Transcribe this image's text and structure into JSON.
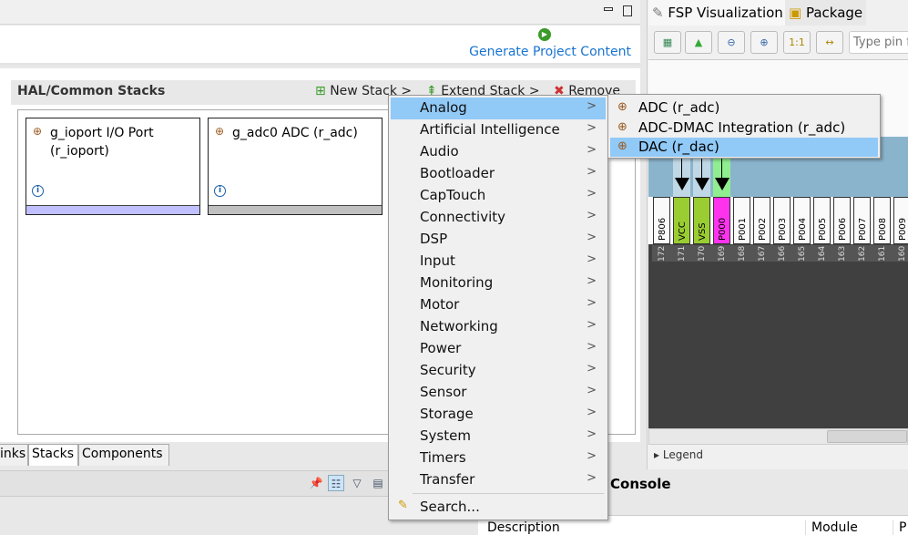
{
  "editor": {
    "generate_label": "Generate Project Content"
  },
  "stacks": {
    "title": "HAL/Common Stacks",
    "new_stack": "New Stack >",
    "extend_stack": "Extend Stack >",
    "remove": "Remove",
    "cards": [
      {
        "label": "g_ioport I/O Port (r_ioport)",
        "bar_color": "#c0c0ff"
      },
      {
        "label": "g_adc0 ADC (r_adc)",
        "bar_color": "#c0c0c0"
      }
    ]
  },
  "bottom_tabs": [
    "inks",
    "Stacks",
    "Components"
  ],
  "console": {
    "title": "Console",
    "columns": [
      "Description",
      "Module",
      "P"
    ]
  },
  "right": {
    "tabs": [
      "FSP Visualization",
      "Package"
    ],
    "search_placeholder": "Type pin f",
    "legend": "Legend",
    "pins": [
      {
        "name": "P806",
        "num": "172"
      },
      {
        "name": "VCC",
        "num": "171",
        "color": "#9acd32"
      },
      {
        "name": "VSS",
        "num": "170",
        "color": "#9acd32"
      },
      {
        "name": "P000",
        "num": "169",
        "color": "#ff33ee"
      },
      {
        "name": "P001",
        "num": "168"
      },
      {
        "name": "P002",
        "num": "167"
      },
      {
        "name": "P003",
        "num": "166"
      },
      {
        "name": "P004",
        "num": "165"
      },
      {
        "name": "P005",
        "num": "164"
      },
      {
        "name": "P006",
        "num": "163"
      },
      {
        "name": "P007",
        "num": "162"
      },
      {
        "name": "P008",
        "num": "161"
      },
      {
        "name": "P009",
        "num": "160"
      }
    ]
  },
  "menu": {
    "items": [
      "Analog",
      "Artificial Intelligence",
      "Audio",
      "Bootloader",
      "CapTouch",
      "Connectivity",
      "DSP",
      "Input",
      "Monitoring",
      "Motor",
      "Networking",
      "Power",
      "Security",
      "Sensor",
      "Storage",
      "System",
      "Timers",
      "Transfer"
    ],
    "search": "Search...",
    "selected": "Analog"
  },
  "submenu": {
    "items": [
      "ADC (r_adc)",
      "ADC-DMAC Integration (r_adc)",
      "DAC (r_dac)"
    ],
    "selected": "DAC (r_dac)"
  },
  "colors": {
    "highlight": "#91c9f7",
    "link": "#1874d0"
  }
}
